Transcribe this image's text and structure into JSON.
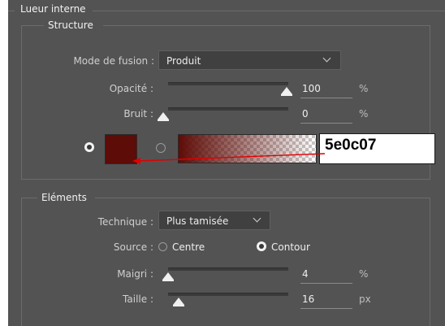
{
  "sections": {
    "outer_title": "Lueur interne",
    "structure_title": "Structure",
    "elements_title": "Eléments"
  },
  "structure": {
    "blend_mode": {
      "label": "Mode de fusion :",
      "value": "Produit"
    },
    "opacity": {
      "label": "Opacité :",
      "value": "100",
      "unit": "%",
      "level": 1.0
    },
    "noise": {
      "label": "Bruit :",
      "value": "0",
      "unit": "%",
      "level": 0.0
    },
    "color": {
      "swatch_hex": "#5e0c07",
      "annotation": "5e0c07",
      "arrow_color": "#e00000"
    }
  },
  "elements": {
    "technique": {
      "label": "Technique :",
      "value": "Plus tamisée"
    },
    "source": {
      "label": "Source :",
      "option_center": "Centre",
      "option_edge": "Contour",
      "selected": "Contour"
    },
    "choke": {
      "label": "Maigri :",
      "value": "4",
      "unit": "%",
      "level": 0.04
    },
    "size": {
      "label": "Taille :",
      "value": "16",
      "unit": "px",
      "level": 0.064
    }
  },
  "icons": {
    "chevron": "chevron-down-icon",
    "radio": "radio-button-icon"
  }
}
